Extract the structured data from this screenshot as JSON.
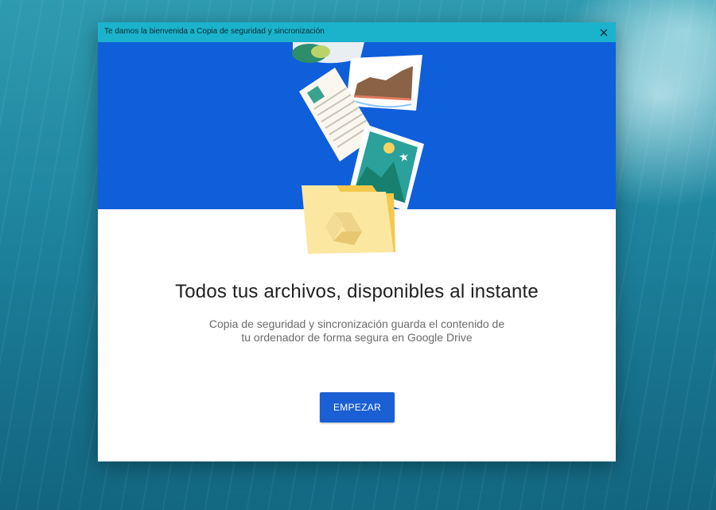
{
  "window": {
    "title": "Te damos la bienvenida a Copia de seguridad y sincronización",
    "close_icon": "close-icon"
  },
  "hero": {
    "background_color": "#0f5fdb",
    "illustration": [
      "map-card-icon",
      "chart-document-icon",
      "text-document-icon",
      "photo-icon",
      "drive-folder-icon"
    ]
  },
  "main": {
    "headline": "Todos tus archivos, disponibles al instante",
    "subtitle_line1": "Copia de seguridad y sincronización guarda el contenido de",
    "subtitle_line2": "tu ordenador de forma segura en Google Drive",
    "start_button": "EMPEZAR"
  },
  "colors": {
    "titlebar": "#1bb3cc",
    "button": "#1a5fd4"
  }
}
